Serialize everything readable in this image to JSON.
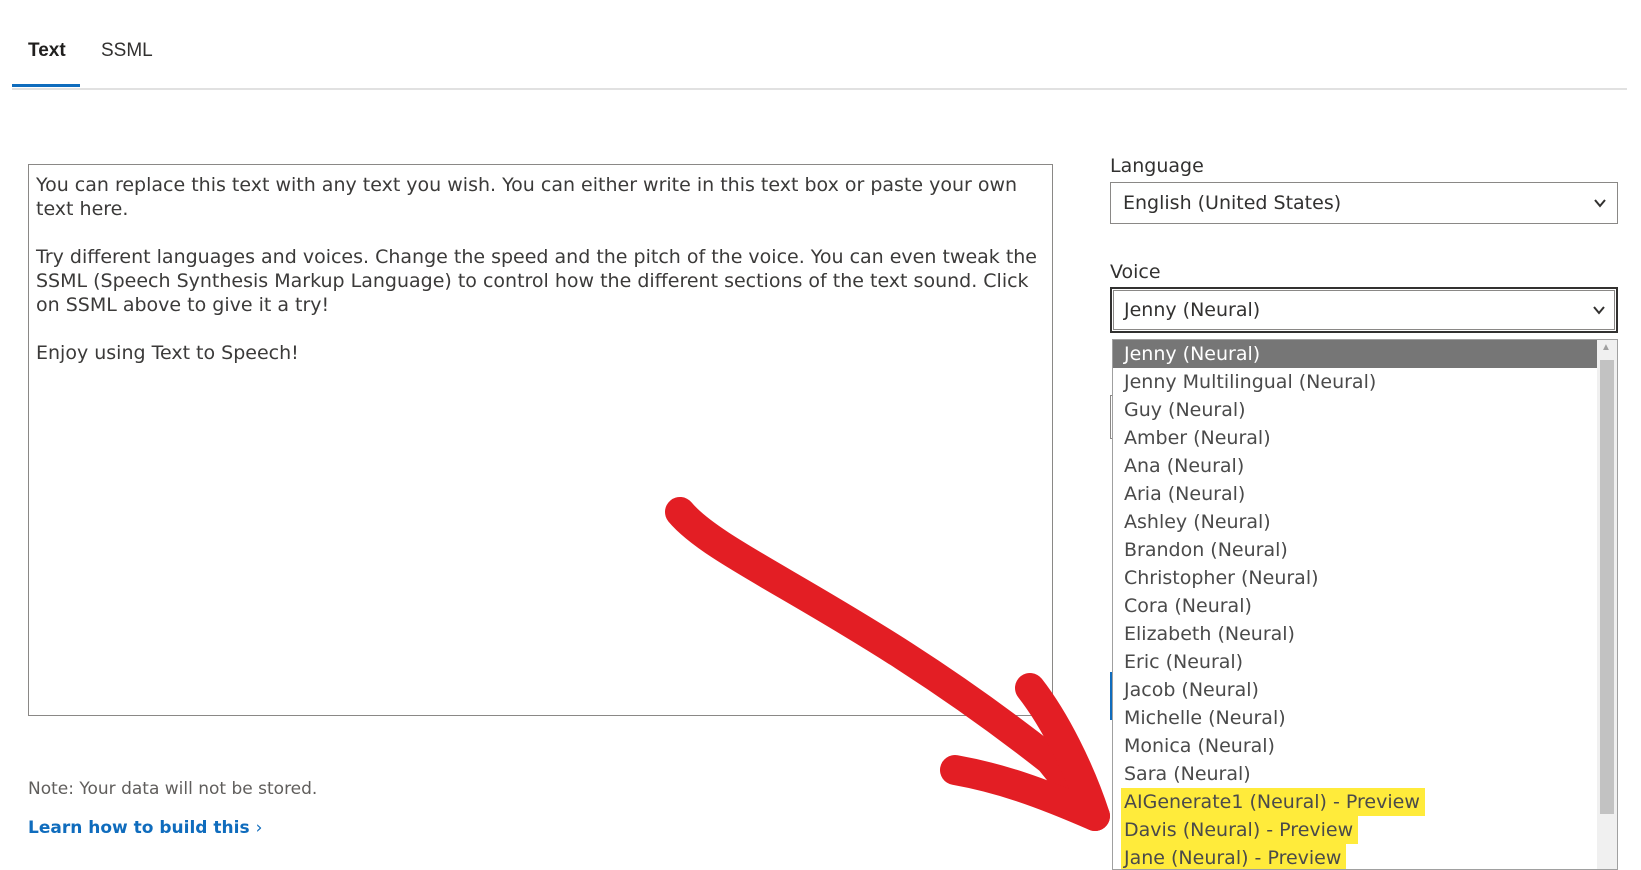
{
  "tabs": [
    {
      "label": "Text",
      "active": true
    },
    {
      "label": "SSML",
      "active": false
    }
  ],
  "editor": {
    "paragraphs": [
      "You can replace this text with any text you wish. You can either write in this text box or paste your own text here.",
      "Try different languages and voices. Change the speed and the pitch of the voice. You can even tweak the SSML (Speech Synthesis Markup Language) to control how the different sections of the text sound. Click on SSML above to give it a try!",
      "Enjoy using Text to Speech!"
    ]
  },
  "note": "Note: Your data will not be stored.",
  "learn_link": "Learn how to build this",
  "language": {
    "label": "Language",
    "selected": "English (United States)"
  },
  "voice": {
    "label": "Voice",
    "selected": "Jenny (Neural)",
    "options": [
      "Jenny (Neural)",
      "Jenny Multilingual (Neural)",
      "Guy (Neural)",
      "Amber (Neural)",
      "Ana (Neural)",
      "Aria (Neural)",
      "Ashley (Neural)",
      "Brandon (Neural)",
      "Christopher (Neural)",
      "Cora (Neural)",
      "Elizabeth (Neural)",
      "Eric (Neural)",
      "Jacob (Neural)",
      "Michelle (Neural)",
      "Monica (Neural)",
      "Sara (Neural)",
      "AIGenerate1 (Neural) - Preview",
      "Davis (Neural) - Preview",
      "Jane (Neural) - Preview"
    ],
    "highlighted_options": [
      "AIGenerate1 (Neural) - Preview",
      "Davis (Neural) - Preview",
      "Jane (Neural) - Preview"
    ]
  },
  "colors": {
    "accent": "#0f6cbd",
    "highlight": "#ffeb3b",
    "annotation": "#e31e24",
    "selected_option": "#767676"
  }
}
